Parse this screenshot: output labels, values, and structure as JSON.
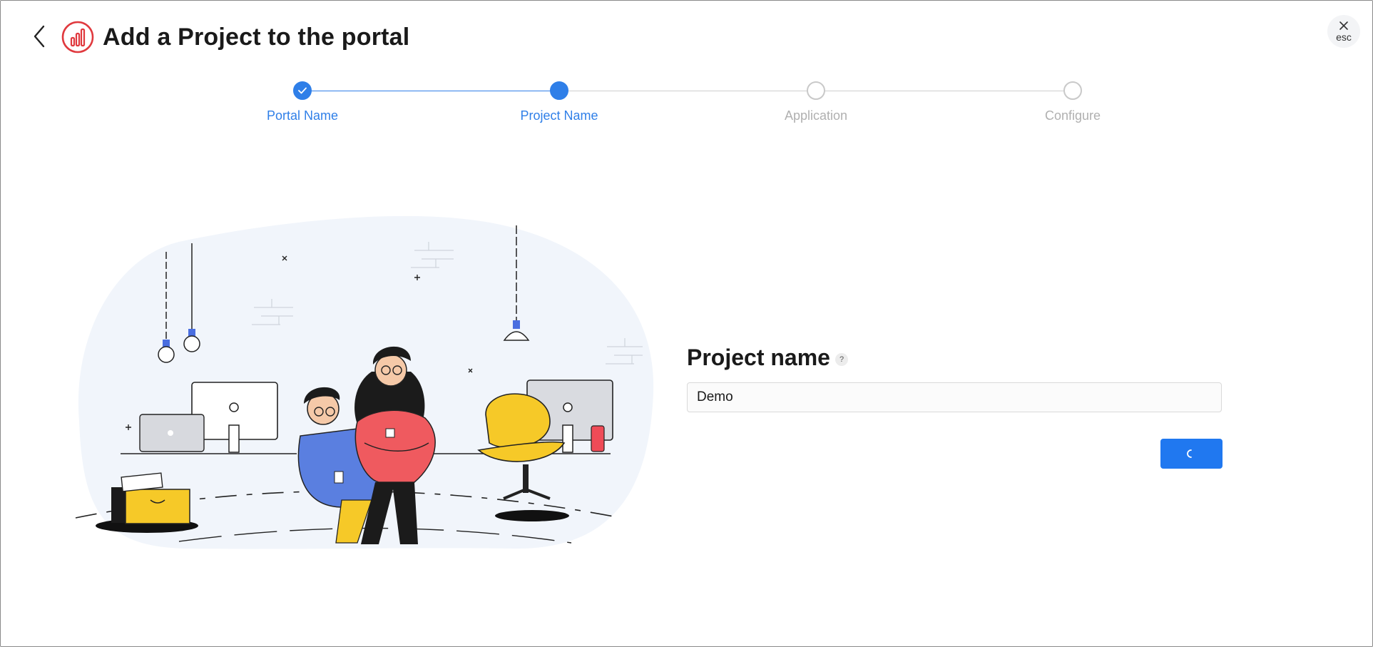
{
  "header": {
    "title": "Add a Project to the portal",
    "close_label": "esc"
  },
  "stepper": {
    "steps": [
      {
        "label": "Portal Name",
        "state": "complete"
      },
      {
        "label": "Project Name",
        "state": "active"
      },
      {
        "label": "Application",
        "state": "pending"
      },
      {
        "label": "Configure",
        "state": "pending"
      }
    ]
  },
  "form": {
    "title": "Project name",
    "help_label": "?",
    "project_name_value": "Demo"
  },
  "colors": {
    "accent": "#2f7fe8",
    "button": "#2078f0",
    "logo": "#e0393e",
    "pending": "#b0b0b0"
  },
  "icons": {
    "back": "chevron-left-icon",
    "logo": "analytics-logo-icon",
    "close": "close-icon",
    "check": "check-icon",
    "help": "help-icon",
    "loading": "spinner-icon"
  }
}
